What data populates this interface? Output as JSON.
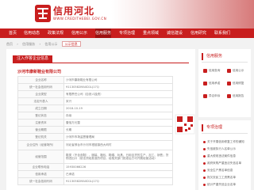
{
  "header": {
    "logo_text": "信用河北",
    "logo_sub": "WWW.CREDITHEBEI.GOV.CN",
    "brand_color": "#c81e1e"
  },
  "nav": {
    "items": [
      "首页",
      "信用动态",
      "政策法规",
      "信用公示",
      "信用服务",
      "专项治理",
      "重点领域",
      "诚信建设",
      "信用研究",
      "联系我们"
    ],
    "active_index": 4
  },
  "breadcrumb": {
    "items": [
      "首页",
      "信用服务",
      "信用公示",
      "公示信息"
    ]
  },
  "main": {
    "title": "注入作答企业信息",
    "company_name": "沙河市康新鞋业有限公司",
    "rows": [
      {
        "key": "企业名称",
        "value": "沙河市康新鞋业有限公司"
      },
      {
        "key": "统一社会信用代码",
        "value": "91130582MA0D1LJ17Q"
      },
      {
        "key": "企业类型",
        "value": "有限责任公司（自然人独资）"
      },
      {
        "key": "法定代表人",
        "value": "宋兴"
      },
      {
        "key": "成立日期",
        "value": "2018-10-19"
      },
      {
        "key": "登记状态",
        "value": "存续"
      },
      {
        "key": "注册资本",
        "value": "壹佰万元整"
      },
      {
        "key": "营业期限",
        "value": "长期"
      },
      {
        "key": "登记机关",
        "value": "沙河市市场监督管理局"
      },
      {
        "key": "企业住所（经营场所）",
        "value": "河北省邢台市沙河市褡裢镇西大坞村"
      },
      {
        "key": "经营范围",
        "value": "鞋类（不含皮鞋）、服装、箱包、鞋帽、玩具、日用百货的生产、加工、销售；货物进出口（依法须经批准的项目，经相关部门批准后方可开展经营活动）"
      },
      {
        "key": "企业联系电话",
        "value": "15930066226"
      },
      {
        "key": "信用承诺",
        "value": "已承诺"
      },
      {
        "key": "统一社会信用代码",
        "value": "91130582MA0D1LJ17Q"
      }
    ]
  },
  "sidebar_services": {
    "title": "信用服务",
    "items": [
      "信用查询",
      "信用公示",
      "信用承诺",
      "信用修复",
      "异议申诉",
      "信用报告"
    ]
  },
  "sidebar_topics": {
    "title": "专项治理",
    "items": [
      "关于开展信用修复工作的通知",
      "失信被执行人名单公示",
      "重大税收违法案件信息",
      "政府采购严重违法失信名单",
      "安全生产黑名单信息",
      "拖欠农民工工资黑名单",
      "统计严重失信企业名单"
    ]
  }
}
